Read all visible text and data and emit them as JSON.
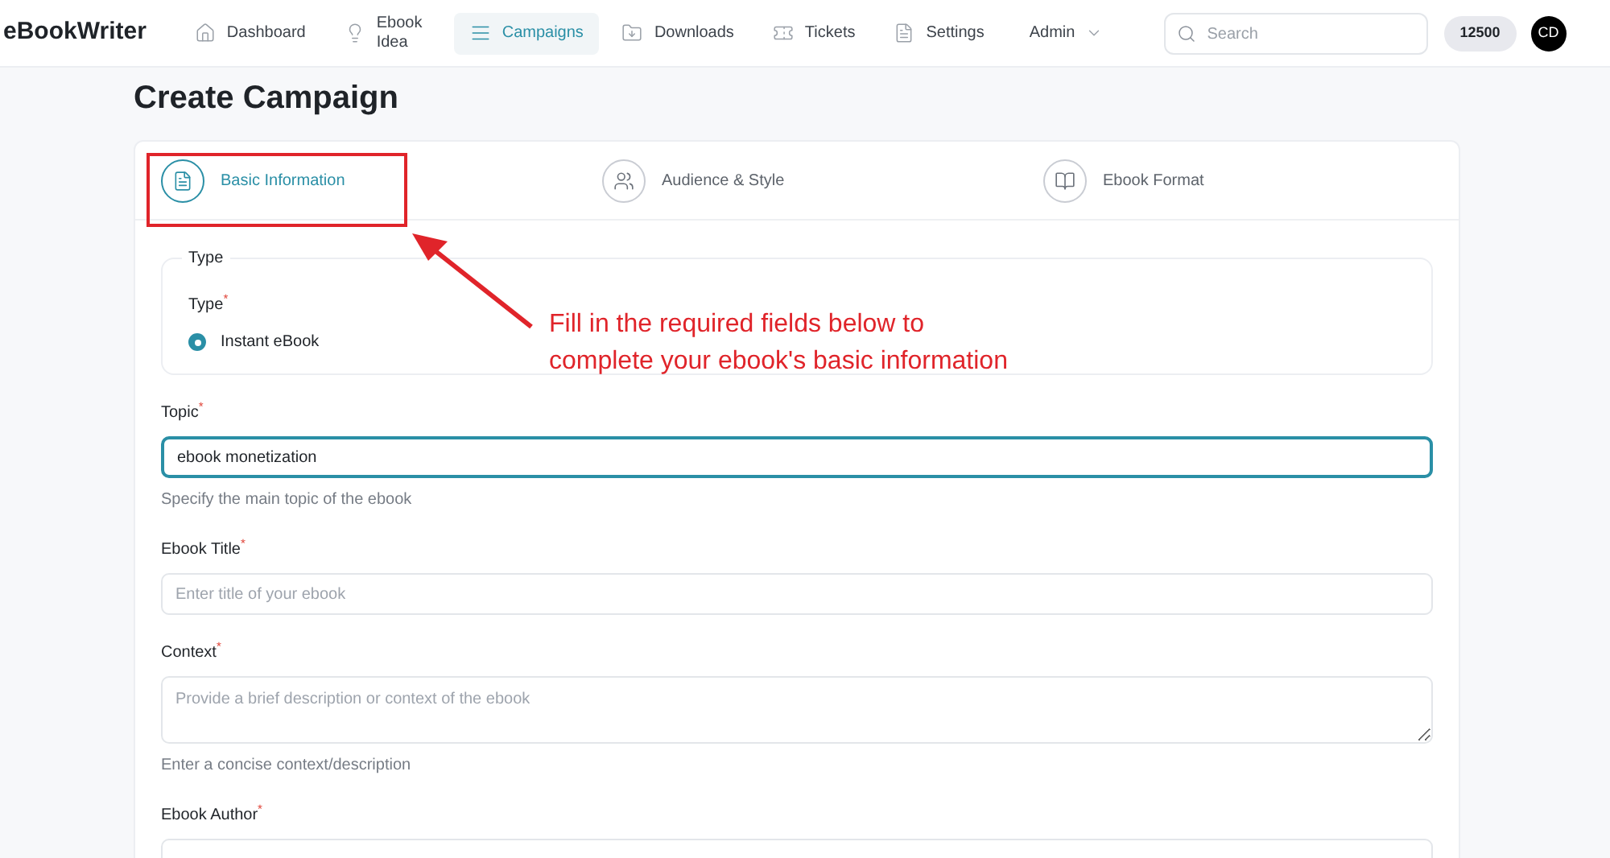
{
  "header": {
    "logo": "eBookWriter",
    "nav": [
      {
        "label": "Dashboard",
        "selected": false
      },
      {
        "label": "Ebook Idea",
        "selected": false
      },
      {
        "label": "Campaigns",
        "selected": true
      },
      {
        "label": "Downloads",
        "selected": false
      },
      {
        "label": "Tickets",
        "selected": false
      },
      {
        "label": "Settings",
        "selected": false
      },
      {
        "label": "Admin",
        "selected": false
      }
    ],
    "search": {
      "placeholder": "Search"
    },
    "credits": "12500",
    "avatar": "CD"
  },
  "page_title": "Create Campaign",
  "steps": [
    {
      "label": "Basic Information",
      "selected": true
    },
    {
      "label": "Audience & Style",
      "selected": false
    },
    {
      "label": "Ebook Format",
      "selected": false
    }
  ],
  "type_group": {
    "legend": "Type",
    "label": "Type",
    "required_mark": "*",
    "options": [
      {
        "label": "Instant eBook",
        "selected": true
      }
    ]
  },
  "fields": [
    {
      "kind": "input",
      "label": "Topic",
      "required_mark": "*",
      "value": "ebook monetization",
      "focused": true,
      "hint": "Specify the main topic of the ebook"
    },
    {
      "kind": "input",
      "label": "Ebook Title",
      "required_mark": "*",
      "placeholder": "Enter title of your ebook",
      "focused": false
    },
    {
      "kind": "textarea",
      "label": "Context",
      "required_mark": "*",
      "placeholder": "Provide a brief description or context of the ebook",
      "focused": false,
      "hint": "Enter a concise context/description"
    },
    {
      "kind": "input",
      "label": "Ebook Author",
      "required_mark": "*",
      "focused": false
    }
  ],
  "annotation": {
    "lines": [
      "Fill in the required fields below to",
      "complete your ebook's basic information"
    ]
  }
}
